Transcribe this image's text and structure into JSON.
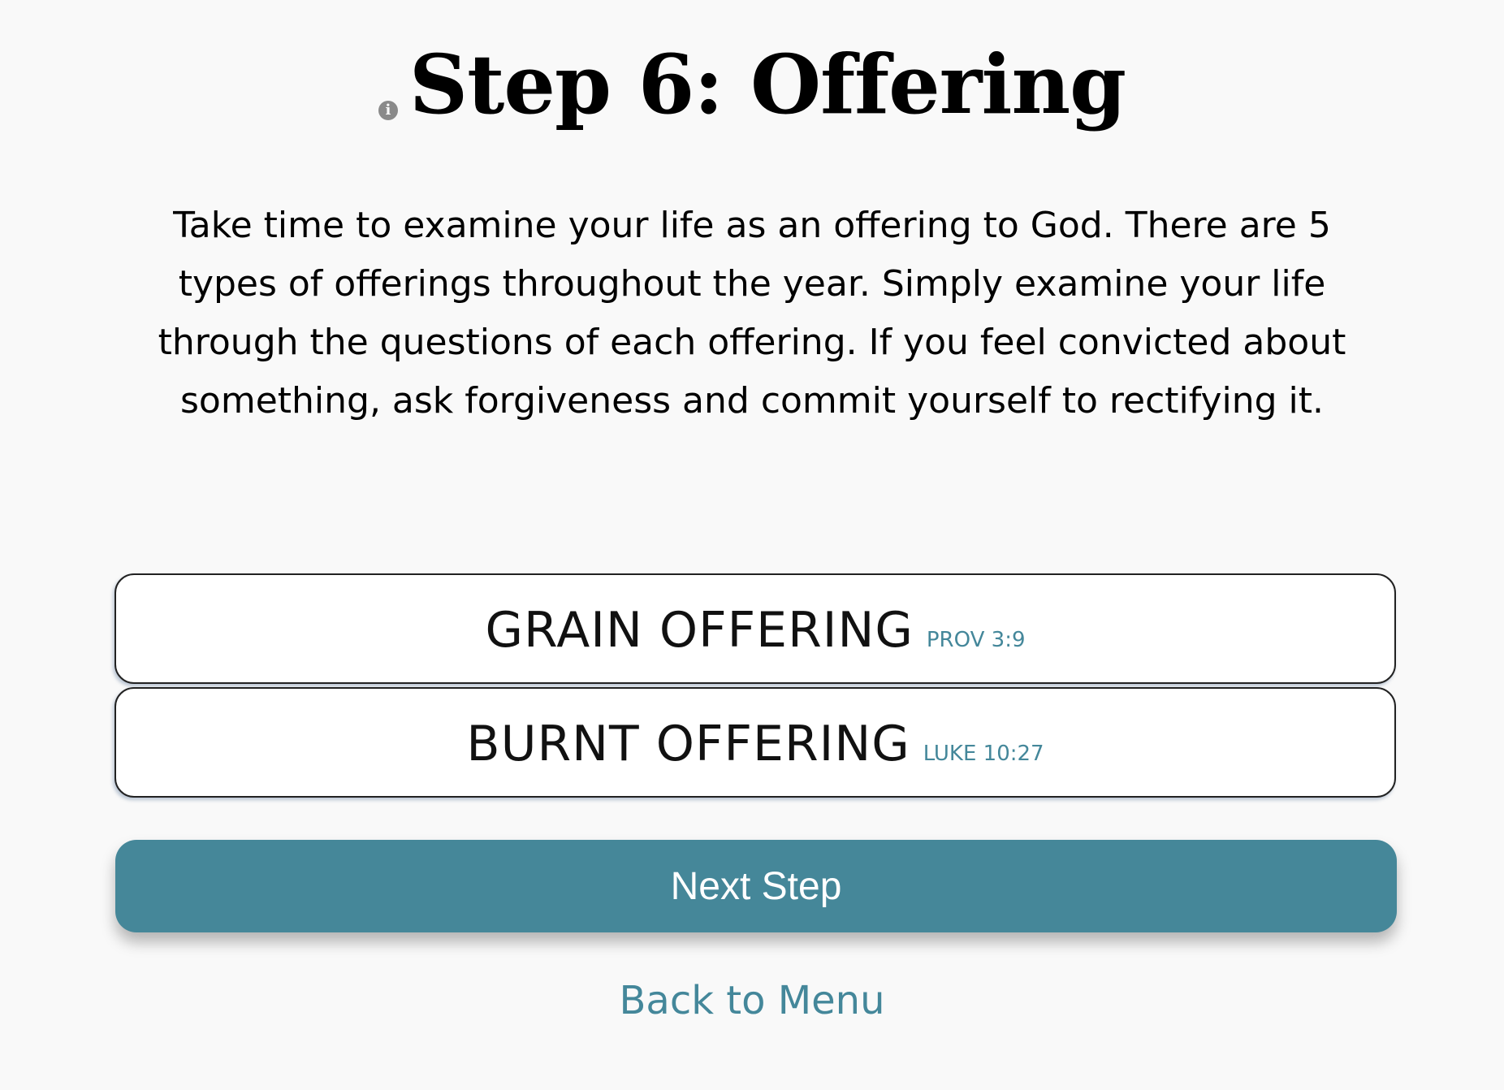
{
  "header": {
    "info_icon": "info-icon",
    "info_glyph": "i",
    "title": "Step 6: Offering"
  },
  "intro": {
    "text": "Take time to examine your life as an offering to God. There are 5 types of offerings throughout the year. Simply examine your life through the questions of each offering. If you feel convicted about something, ask forgiveness and commit yourself to rectifying it."
  },
  "offerings": [
    {
      "name": "GRAIN OFFERING",
      "reference": "PROV 3:9"
    },
    {
      "name": "BURNT OFFERING",
      "reference": "LUKE 10:27"
    }
  ],
  "actions": {
    "next_label": "Next Step",
    "back_label": "Back to Menu"
  },
  "colors": {
    "accent": "#458799",
    "reference_text": "#44879a",
    "background": "#f9f9f9"
  }
}
